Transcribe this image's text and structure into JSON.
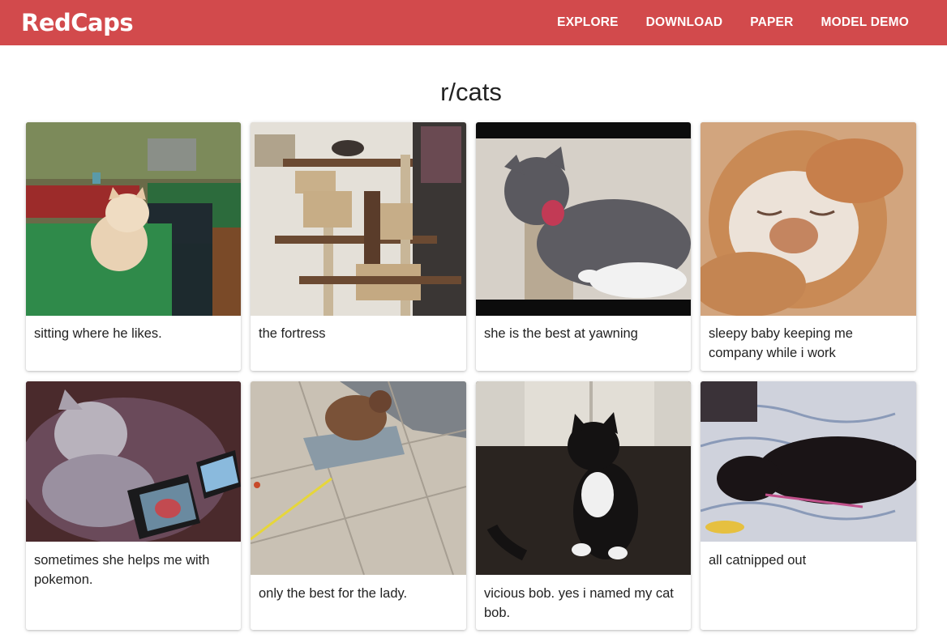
{
  "brand": "RedCaps",
  "nav": {
    "explore": "EXPLORE",
    "download": "DOWNLOAD",
    "paper": "PAPER",
    "model_demo": "MODEL DEMO"
  },
  "page_title": "r/cats",
  "cards": [
    {
      "caption": "sitting where he likes.",
      "image": "cream-cat-on-green-bin"
    },
    {
      "caption": "the fortress",
      "image": "cat-tree-tower"
    },
    {
      "caption": "she is the best at yawning",
      "image": "grey-cat-yawning"
    },
    {
      "caption": "sleepy baby keeping me company while i work",
      "image": "orange-white-cat-sleeping"
    },
    {
      "caption": "sometimes she helps me with pokemon.",
      "image": "white-cat-with-game-console"
    },
    {
      "caption": "only the best for the lady.",
      "image": "cat-on-cushion-tile-floor"
    },
    {
      "caption": "vicious bob. yes i named my cat bob.",
      "image": "tuxedo-cat-by-door"
    },
    {
      "caption": "all catnipped out",
      "image": "black-cat-on-blanket"
    }
  ]
}
